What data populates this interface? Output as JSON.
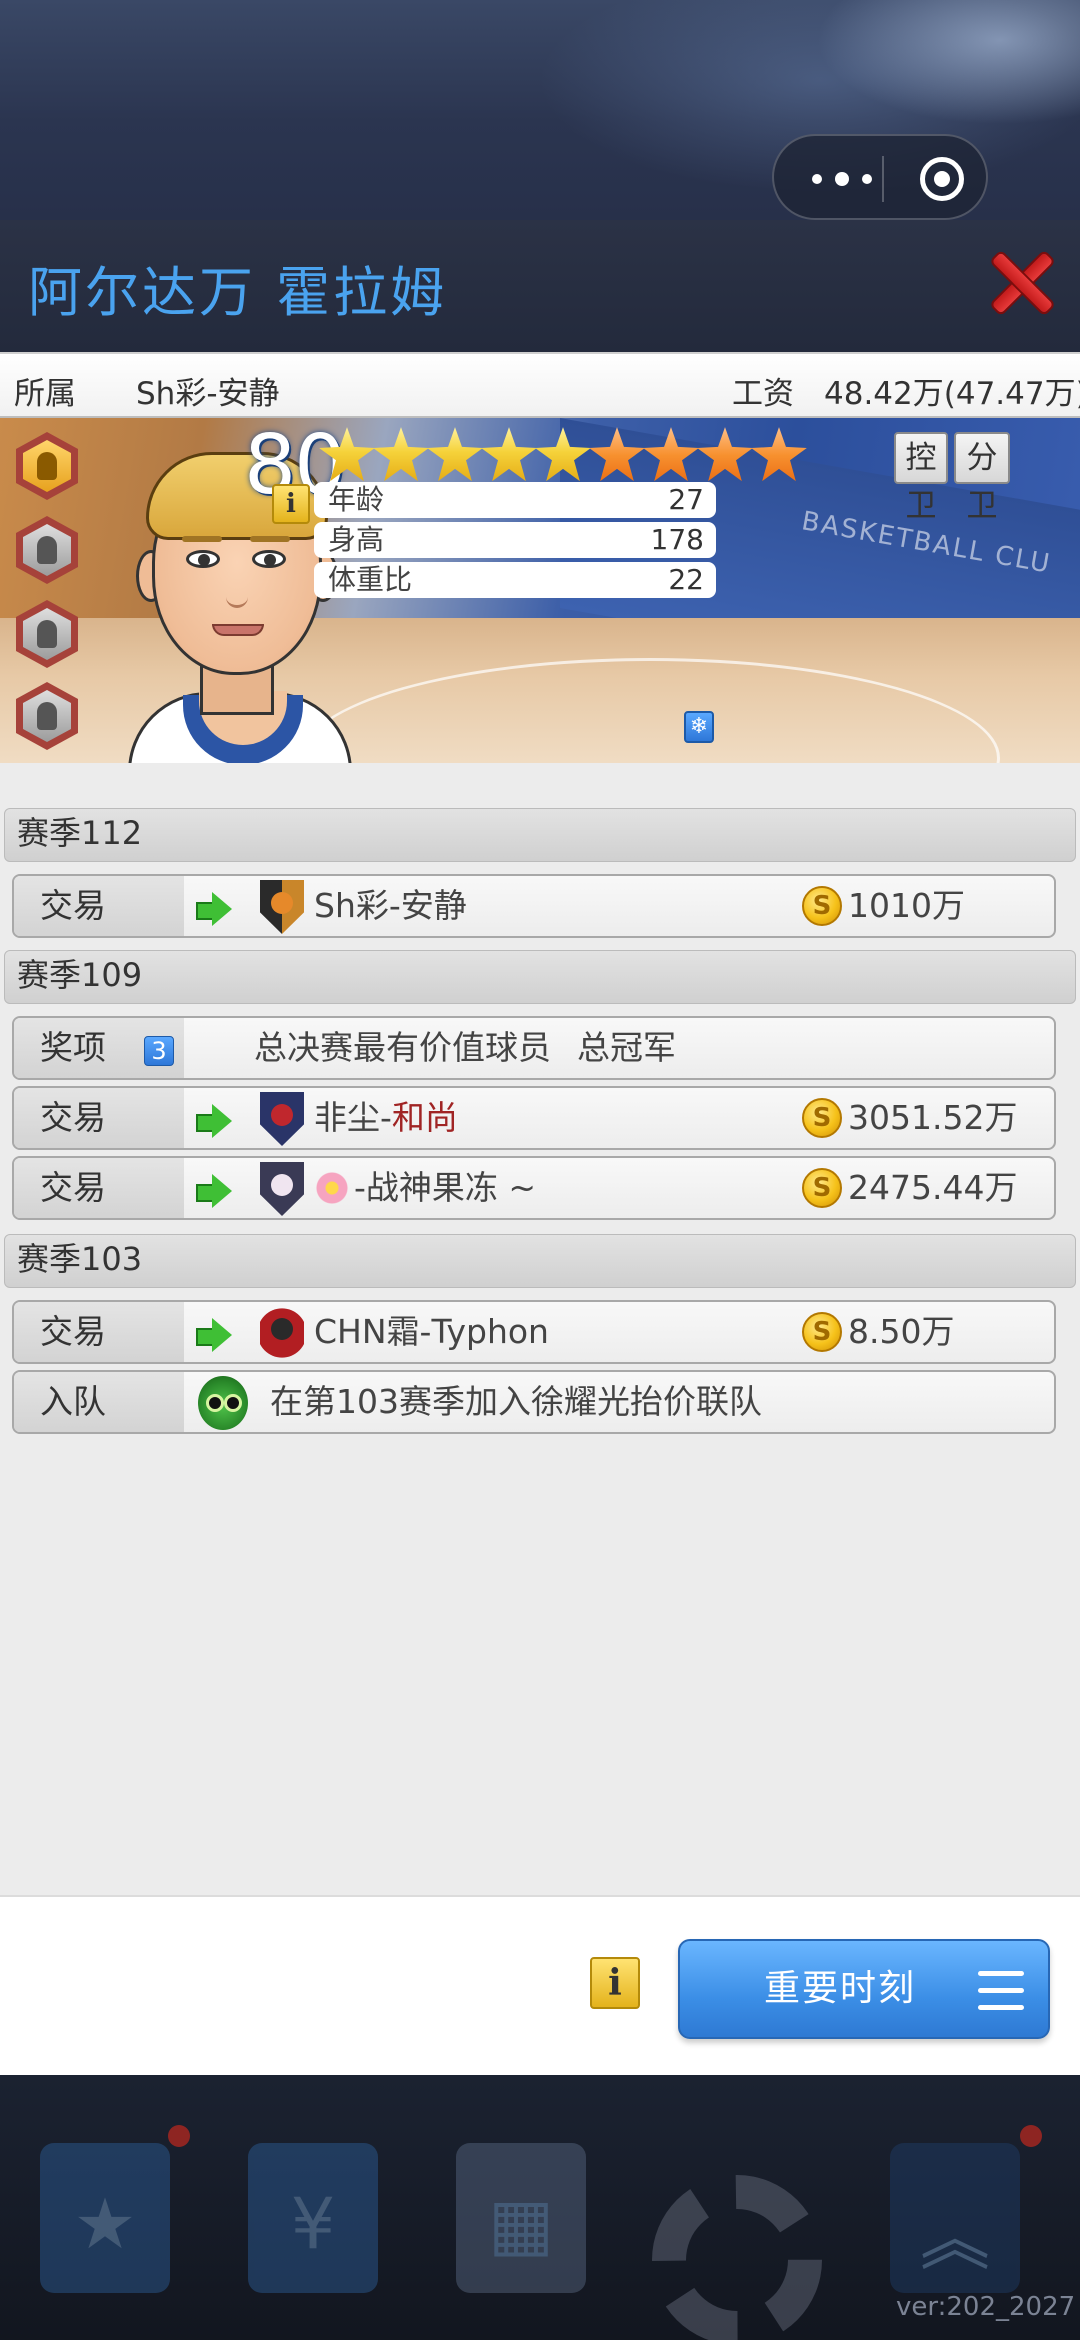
{
  "header": {
    "capsule": {
      "more_icon": "more-dots-icon",
      "close_icon": "target-circle-icon"
    }
  },
  "player": {
    "name": "阿尔达万 霍拉姆",
    "team_label": "所属",
    "team": "Sh彩-安静",
    "salary_label": "工资",
    "salary": "48.42万(47.47万)",
    "rating": "80",
    "stars_total": 9,
    "stars_gold": 5,
    "stars_orange": 4,
    "positions": [
      "控卫",
      "分卫"
    ],
    "info_icon": "i",
    "stats": [
      {
        "label": "年龄",
        "value": "27"
      },
      {
        "label": "身高",
        "value": "178"
      },
      {
        "label": "体重比",
        "value": "22"
      }
    ],
    "background_text": "BASKETBALL CLU"
  },
  "history": [
    {
      "season": "赛季112",
      "events": [
        {
          "type": "交易",
          "team": "Sh彩-安静",
          "amount": "1010万"
        }
      ]
    },
    {
      "season": "赛季109",
      "events": [
        {
          "type": "奖项",
          "count": "3",
          "awards": [
            "总决赛最有价值球员",
            "总冠军"
          ]
        },
        {
          "type": "交易",
          "team_prefix": "非尘-",
          "team_highlight": "和尚",
          "amount": "3051.52万"
        },
        {
          "type": "交易",
          "team": "-战神果冻 ~",
          "amount": "2475.44万"
        }
      ]
    },
    {
      "season": "赛季103",
      "events": [
        {
          "type": "交易",
          "team": "CHN霜-Typhon",
          "amount": "8.50万"
        },
        {
          "type": "入队",
          "text": "在第103赛季加入徐耀光抬价联队"
        }
      ]
    }
  ],
  "footer": {
    "info_label": "i",
    "moments_button": "重要时刻"
  },
  "coin_symbol": "S",
  "version": "ver:202_2027",
  "colors": {
    "name": "#4aa3ef",
    "accent_button": "#3b8ee6",
    "close": "#d22a2a"
  }
}
